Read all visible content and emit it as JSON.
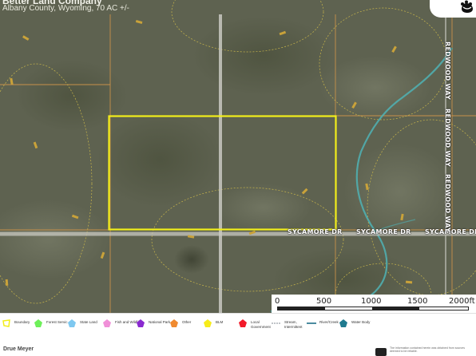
{
  "header": {
    "company": "Better Land Company",
    "subtitle": "Albany County, Wyoming, 70 AC +/-"
  },
  "map": {
    "road_labels": {
      "sycamore_1": "SYCAMORE DR",
      "sycamore_2": "SYCAMORE DR",
      "sycamore_3": "SYCAMORE DR",
      "redwood_1": "REDWOOD WAY",
      "redwood_2": "REDWOOD WAY",
      "redwood_3": "REDWOOD WAY"
    },
    "scale": {
      "ticks": [
        "0",
        "500",
        "1000",
        "1500",
        "2000ft"
      ]
    },
    "colors": {
      "boundary": "#f2ee1a",
      "parcel_lines": "#c8914a",
      "contour": "#c9b64a",
      "creek": "#4fb3b5",
      "road": "#c9c9c2"
    }
  },
  "legend": {
    "items": [
      {
        "label": "Boundary",
        "color": "#f2ee1a",
        "icon": "boundary-icon"
      },
      {
        "label": "Forest Servic",
        "color": "#6ef05a",
        "icon": "forest-service-icon"
      },
      {
        "label": "State Land",
        "color": "#7ec8f0",
        "icon": "state-land-icon"
      },
      {
        "label": "Fish and Wildlife",
        "color": "#f090d8",
        "icon": "fish-wildlife-icon"
      },
      {
        "label": "National Park",
        "color": "#8a2ad0",
        "icon": "national-park-icon"
      },
      {
        "label": "Other",
        "color": "#f08a30",
        "icon": "other-icon"
      },
      {
        "label": "BLM",
        "color": "#f7ec1a",
        "icon": "blm-icon"
      },
      {
        "label": "Local Government",
        "color": "#f21a2a",
        "icon": "local-government-icon"
      },
      {
        "label": "Stream, Intermittent",
        "color": "#9aa0a6",
        "icon": "stream-icon"
      },
      {
        "label": "River/Creek",
        "color": "#1f6f88",
        "icon": "river-creek-icon"
      },
      {
        "label": "Water Body",
        "color": "#1f7a8f",
        "icon": "water-body-icon"
      }
    ]
  },
  "footer": {
    "agent": "Drue Meyer",
    "disclaimer": "The information contained herein was obtained from sources deemed to be reliable."
  }
}
